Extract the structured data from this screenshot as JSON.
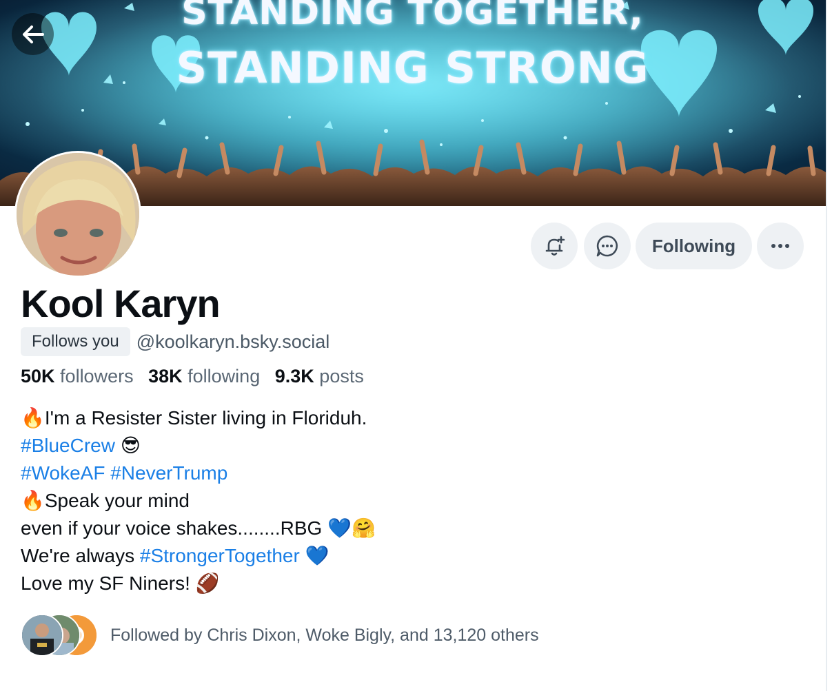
{
  "banner": {
    "line1": "STANDING TOGETHER,",
    "line2": "STANDING STRONG"
  },
  "nav": {
    "back_icon": "arrow-left-icon"
  },
  "profile": {
    "display_name": "Kool Karyn",
    "follows_you_badge": "Follows you",
    "handle": "@koolkaryn.bsky.social",
    "stats": {
      "followers_count": "50K",
      "followers_label": "followers",
      "following_count": "38K",
      "following_label": "following",
      "posts_count": "9.3K",
      "posts_label": "posts"
    }
  },
  "actions": {
    "subscribe_icon": "bell-plus-icon",
    "message_icon": "chat-bubble-icon",
    "following_label": "Following",
    "more_icon": "ellipsis-icon"
  },
  "bio": {
    "l1_emoji": "🔥",
    "l1_text": "I'm a Resister Sister living in Floriduh.",
    "l2_tag": "#BlueCrew",
    "l2_emoji": "😎",
    "l3_tag1": "#WokeAF",
    "l3_tag2": "#NeverTrump",
    "l4_emoji": "🔥",
    "l4_text": "Speak your mind",
    "l5_text": "even if your voice shakes........RBG",
    "l5_emoji": "💙🤗",
    "l6_text": "We're always",
    "l6_tag": "#StrongerTogether",
    "l6_emoji": "💙",
    "l7_text": "Love my SF Niners!",
    "l7_emoji": "🏈"
  },
  "followed_by": {
    "text": "Followed by Chris Dixon, Woke Bigly, and 13,120 others"
  },
  "colors": {
    "link": "#1a7fe6",
    "button_bg": "#eef1f4",
    "text_primary": "#0b0f14",
    "text_secondary": "#5a6774"
  }
}
